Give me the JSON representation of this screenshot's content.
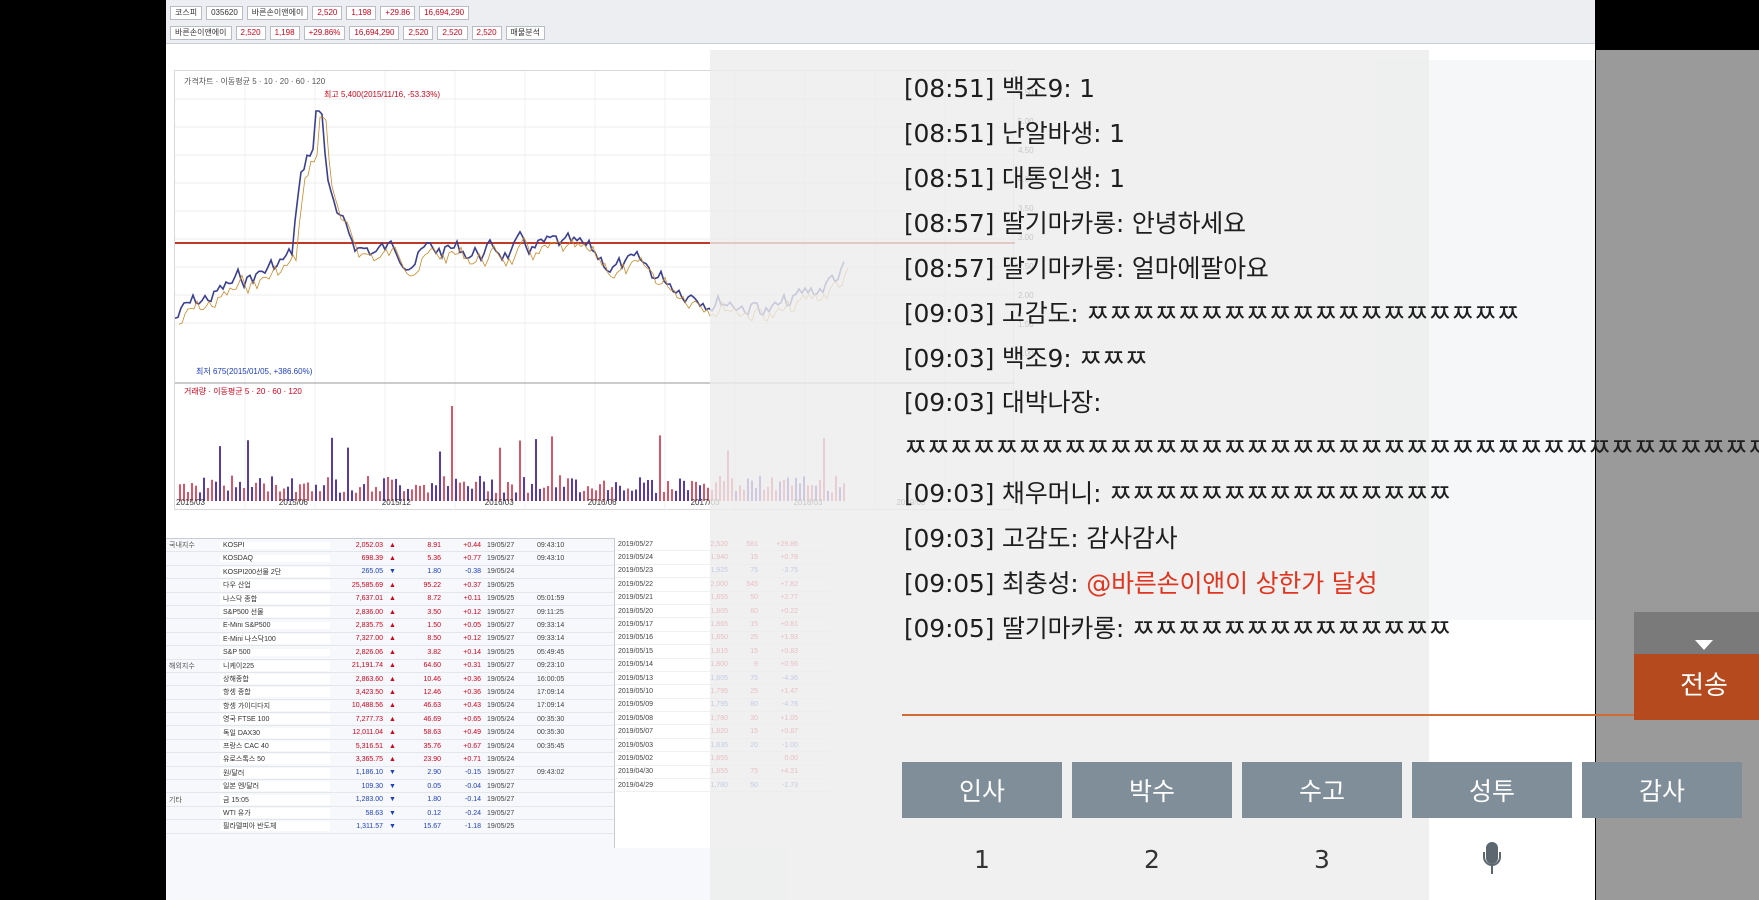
{
  "background_app": {
    "toolbar_row1": [
      "코스피",
      "035620",
      "바른손이앤에이",
      "2,520",
      "1,198",
      "+29.86",
      "16,694,290"
    ],
    "toolbar_row2": [
      "바른손이앤에이",
      "2,520",
      "1,198",
      "+29.86%",
      "16,694,290",
      "2,520",
      "2,520",
      "2,520",
      "매물분석"
    ],
    "chart_legend": "가격차트 · 이동평균 5 · 10 · 20 · 60 · 120",
    "chart_high": "최고 5,400(2015/11/16, -53.33%)",
    "chart_low": "최저 675(2015/01/05, +386.60%)",
    "volume_legend": "거래량 · 이동평균 5 · 20 · 60 · 120",
    "price_scale": [
      "5.50",
      "5.00",
      "4.50",
      "4.00",
      "3.50",
      "3.00",
      "2.50",
      "2.00",
      "1.50",
      "1.00"
    ],
    "dates": [
      "2015/03",
      "2015/06",
      "2015/12",
      "2016/03",
      "2016/06",
      "2017/03",
      "2018/03",
      "2019/03"
    ],
    "indices": [
      {
        "group": "국내지수",
        "name": "KOSPI",
        "price": "2,052.03",
        "dir": "▲",
        "chg": "8.91",
        "pct": "+0.44",
        "date": "19/05/27",
        "time": "09:43:10",
        "down": false
      },
      {
        "group": "",
        "name": "KOSDAQ",
        "price": "698.39",
        "dir": "▲",
        "chg": "5.36",
        "pct": "+0.77",
        "date": "19/05/27",
        "time": "09:43:10",
        "down": false
      },
      {
        "group": "",
        "name": "KOSPI200선물 2단",
        "price": "265.05",
        "dir": "▼",
        "chg": "1.80",
        "pct": "-0.38",
        "date": "19/05/24",
        "time": "",
        "down": true
      },
      {
        "group": "",
        "name": "다우 산업",
        "price": "25,585.69",
        "dir": "▲",
        "chg": "95.22",
        "pct": "+0.37",
        "date": "19/05/25",
        "time": "",
        "down": false
      },
      {
        "group": "",
        "name": "나스닥 종합",
        "price": "7,637.01",
        "dir": "▲",
        "chg": "8.72",
        "pct": "+0.11",
        "date": "19/05/25",
        "time": "05:01:59",
        "down": false
      },
      {
        "group": "",
        "name": "S&P500 선물",
        "price": "2,836.00",
        "dir": "▲",
        "chg": "3.50",
        "pct": "+0.12",
        "date": "19/05/27",
        "time": "09:11:25",
        "down": false
      },
      {
        "group": "",
        "name": "E-Mini S&P500",
        "price": "2,835.75",
        "dir": "▲",
        "chg": "1.50",
        "pct": "+0.05",
        "date": "19/05/27",
        "time": "09:33:14",
        "down": false
      },
      {
        "group": "",
        "name": "E-Mini 나스닥100",
        "price": "7,327.00",
        "dir": "▲",
        "chg": "8.50",
        "pct": "+0.12",
        "date": "19/05/27",
        "time": "09:33:14",
        "down": false
      },
      {
        "group": "",
        "name": "S&P 500",
        "price": "2,826.06",
        "dir": "▲",
        "chg": "3.82",
        "pct": "+0.14",
        "date": "19/05/25",
        "time": "05:49:45",
        "down": false
      },
      {
        "group": "해외지수",
        "name": "니케이225",
        "price": "21,191.74",
        "dir": "▲",
        "chg": "64.60",
        "pct": "+0.31",
        "date": "19/05/27",
        "time": "09:23:10",
        "down": false
      },
      {
        "group": "",
        "name": "상해종합",
        "price": "2,863.60",
        "dir": "▲",
        "chg": "10.46",
        "pct": "+0.36",
        "date": "19/05/24",
        "time": "16:00:05",
        "down": false
      },
      {
        "group": "",
        "name": "항셍 종합",
        "price": "3,423.50",
        "dir": "▲",
        "chg": "12.46",
        "pct": "+0.36",
        "date": "19/05/24",
        "time": "17:09:14",
        "down": false
      },
      {
        "group": "",
        "name": "항셍 가이디다지",
        "price": "10,488.56",
        "dir": "▲",
        "chg": "46.63",
        "pct": "+0.43",
        "date": "19/05/24",
        "time": "17:09:14",
        "down": false
      },
      {
        "group": "",
        "name": "영국 FTSE 100",
        "price": "7,277.73",
        "dir": "▲",
        "chg": "46.69",
        "pct": "+0.65",
        "date": "19/05/24",
        "time": "00:35:30",
        "down": false
      },
      {
        "group": "",
        "name": "독일 DAX30",
        "price": "12,011.04",
        "dir": "▲",
        "chg": "58.63",
        "pct": "+0.49",
        "date": "19/05/24",
        "time": "00:35:30",
        "down": false
      },
      {
        "group": "",
        "name": "프랑스 CAC 40",
        "price": "5,316.51",
        "dir": "▲",
        "chg": "35.76",
        "pct": "+0.67",
        "date": "19/05/24",
        "time": "00:35:45",
        "down": false
      },
      {
        "group": "",
        "name": "유로스톡스 50",
        "price": "3,365.75",
        "dir": "▲",
        "chg": "23.90",
        "pct": "+0.71",
        "date": "19/05/24",
        "time": "",
        "down": false
      },
      {
        "group": "",
        "name": "원/달러",
        "price": "1,186.10",
        "dir": "▼",
        "chg": "2.90",
        "pct": "-0.15",
        "date": "19/05/27",
        "time": "09:43:02",
        "down": true
      },
      {
        "group": "",
        "name": "일본 엔/달러",
        "price": "109.30",
        "dir": "▼",
        "chg": "0.05",
        "pct": "-0.04",
        "date": "19/05/27",
        "time": "",
        "down": true
      },
      {
        "group": "기타",
        "name": "금 15:05",
        "price": "1,283.00",
        "dir": "▼",
        "chg": "1.80",
        "pct": "-0.14",
        "date": "19/05/27",
        "time": "",
        "down": true
      },
      {
        "group": "",
        "name": "WTI 유가",
        "price": "58.63",
        "dir": "▼",
        "chg": "0.12",
        "pct": "-0.24",
        "date": "19/05/27",
        "time": "",
        "down": true
      },
      {
        "group": "",
        "name": "필라델피아 반도체",
        "price": "1,311.57",
        "dir": "▼",
        "chg": "15.67",
        "pct": "-1.18",
        "date": "19/05/25",
        "time": "",
        "down": true
      }
    ],
    "daily": [
      {
        "date": "2019/05/27",
        "price": "2,520",
        "vol": "581",
        "pct": "+29.86",
        "down": false
      },
      {
        "date": "2019/05/24",
        "price": "1,940",
        "vol": "15",
        "pct": "+0.78",
        "down": false
      },
      {
        "date": "2019/05/23",
        "price": "1,925",
        "vol": "75",
        "pct": "-3.75",
        "down": true
      },
      {
        "date": "2019/05/22",
        "price": "2,000",
        "vol": "545",
        "pct": "+7.82",
        "down": false
      },
      {
        "date": "2019/05/21",
        "price": "1,855",
        "vol": "50",
        "pct": "+2.77",
        "down": false
      },
      {
        "date": "2019/05/20",
        "price": "1,805",
        "vol": "60",
        "pct": "+0.22",
        "down": false
      },
      {
        "date": "2019/05/17",
        "price": "1,865",
        "vol": "15",
        "pct": "+0.81",
        "down": false
      },
      {
        "date": "2019/05/16",
        "price": "1,850",
        "vol": "25",
        "pct": "+1.93",
        "down": false
      },
      {
        "date": "2019/05/15",
        "price": "1,815",
        "vol": "15",
        "pct": "+0.83",
        "down": false
      },
      {
        "date": "2019/05/14",
        "price": "1,800",
        "vol": "9",
        "pct": "+0.56",
        "down": false
      },
      {
        "date": "2019/05/13",
        "price": "1,805",
        "vol": "75",
        "pct": "-4.36",
        "down": true
      },
      {
        "date": "2019/05/10",
        "price": "1,795",
        "vol": "25",
        "pct": "+1.47",
        "down": false
      },
      {
        "date": "2019/05/09",
        "price": "1,795",
        "vol": "80",
        "pct": "-4.76",
        "down": true
      },
      {
        "date": "2019/05/08",
        "price": "1,780",
        "vol": "30",
        "pct": "+1.05",
        "down": false
      },
      {
        "date": "2019/05/07",
        "price": "1,820",
        "vol": "15",
        "pct": "+0.87",
        "down": false
      },
      {
        "date": "2019/05/03",
        "price": "1,835",
        "vol": "20",
        "pct": "-1.00",
        "down": true
      },
      {
        "date": "2019/05/02",
        "price": "1,855",
        "vol": "",
        "pct": "0.00",
        "down": false
      },
      {
        "date": "2019/04/30",
        "price": "1,855",
        "vol": "75",
        "pct": "+4.21",
        "down": false
      },
      {
        "date": "2019/04/29",
        "price": "1,780",
        "vol": "50",
        "pct": "-2.73",
        "down": true
      }
    ]
  },
  "chat": {
    "messages": [
      {
        "text": "[08:51] 백조9: 1",
        "mention": ""
      },
      {
        "text": "[08:51] 난알바생: 1",
        "mention": ""
      },
      {
        "text": "[08:51] 대통인생: 1",
        "mention": ""
      },
      {
        "text": "[08:57] 딸기마카롱: 안녕하세요",
        "mention": ""
      },
      {
        "text": "[08:57] 딸기마카롱: 얼마에팔아요",
        "mention": ""
      },
      {
        "text": "[09:03] 고감도: ㅉㅉㅉㅉㅉㅉㅉㅉㅉㅉㅉㅉㅉㅉㅉㅉㅉㅉㅉ",
        "mention": ""
      },
      {
        "text": "[09:03] 백조9: ㅉㅉㅉ",
        "mention": ""
      },
      {
        "text": "[09:03] 대박나장:",
        "mention": ""
      },
      {
        "text": "ㅉㅉㅉㅉㅉㅉㅉㅉㅉㅉㅉㅉㅉㅉㅉㅉㅉㅉㅉㅉㅉㅉㅉㅉㅉㅉㅉㅉㅉㅉㅉㅉㅉㅉㅉㅉㅉㅉ",
        "mention": ""
      },
      {
        "text": "[09:03] 채우머니: ㅉㅉㅉㅉㅉㅉㅉㅉㅉㅉㅉㅉㅉㅉㅉ",
        "mention": ""
      },
      {
        "text": "[09:03] 고감도: 감사감사",
        "mention": ""
      },
      {
        "text": "[09:05] 최충성: ",
        "mention": "@바른손이앤이 상한가 달성"
      },
      {
        "text": "[09:05] 딸기마카롱: ㅉㅉㅉㅉㅉㅉㅉㅉㅉㅉㅉㅉㅉㅉ",
        "mention": ""
      }
    ],
    "send_label": "전송",
    "quick_replies": [
      "인사",
      "박수",
      "수고",
      "성투",
      "감사"
    ],
    "number_keys": [
      "1",
      "2",
      "3"
    ]
  }
}
